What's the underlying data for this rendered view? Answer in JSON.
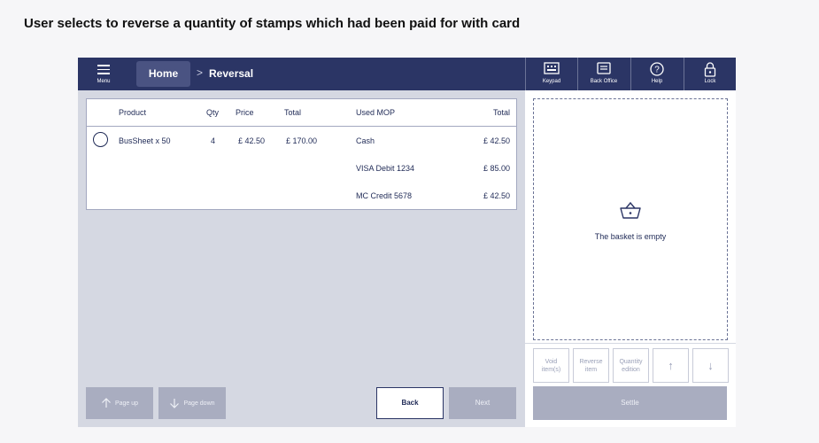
{
  "caption": "User selects to reverse a quantity of stamps which had been paid for with card",
  "topbar": {
    "menu_label": "Menu",
    "home_label": "Home",
    "breadcrumb_sep": ">",
    "current_page": "Reversal",
    "buttons": [
      {
        "label": "Keypad",
        "icon": "keypad-icon"
      },
      {
        "label": "Back Office",
        "icon": "back-office-icon"
      },
      {
        "label": "Help",
        "icon": "help-icon"
      },
      {
        "label": "Lock",
        "icon": "lock-icon"
      }
    ]
  },
  "table": {
    "headers": {
      "product": "Product",
      "qty": "Qty",
      "price": "Price",
      "total": "Total",
      "used_mop": "Used MOP",
      "mop_total": "Total"
    },
    "row": {
      "product": "BusSheet x 50",
      "qty": "4",
      "price": "£ 42.50",
      "total": "£ 170.00"
    },
    "mops": [
      {
        "name": "Cash",
        "amount": "£ 42.50"
      },
      {
        "name": "VISA Debit 1234",
        "amount": "£ 85.00"
      },
      {
        "name": "MC Credit 5678",
        "amount": "£ 42.50"
      }
    ]
  },
  "footer": {
    "page_up": "Page up",
    "page_down": "Page down",
    "back": "Back",
    "next": "Next"
  },
  "basket": {
    "empty_text": "The basket is empty",
    "actions": {
      "void_line1": "Void",
      "void_line2": "item(s)",
      "reverse_line1": "Reverse",
      "reverse_line2": "item",
      "qty_line1": "Quantity",
      "qty_line2": "edition",
      "up": "↑",
      "down": "↓"
    },
    "settle": "Settle"
  },
  "colors": {
    "nav": "#2b3565",
    "accent": "#1f2a56",
    "disabled": "#a9adc0",
    "panel": "#d5d8e2"
  }
}
